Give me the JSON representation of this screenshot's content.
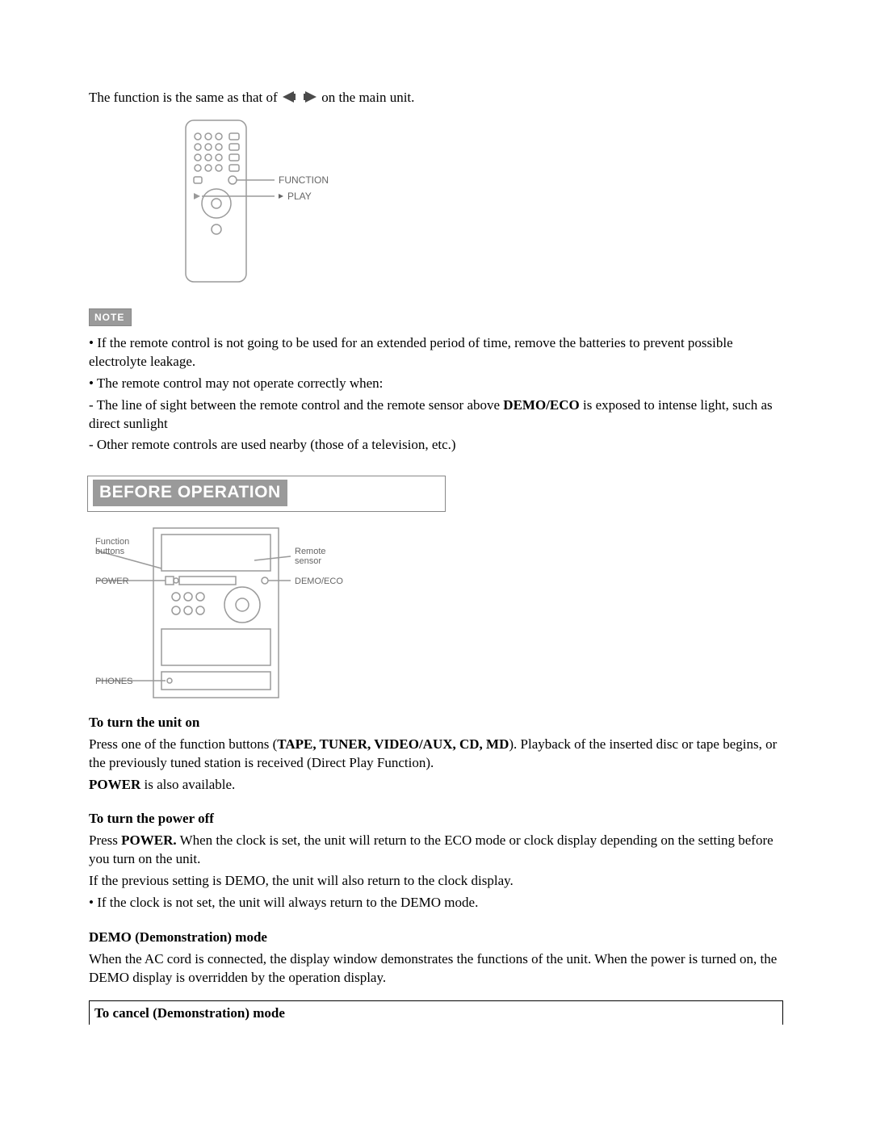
{
  "intro": {
    "pre": "The function is the same as that of ",
    "post": " on the main unit."
  },
  "remote_fig": {
    "label_function": "FUNCTION",
    "label_play": "PLAY"
  },
  "note": {
    "badge": "NOTE",
    "bullet1": "• If the remote control is not going to be used for an extended period of time, remove the batteries to prevent possible electrolyte leakage.",
    "bullet2": "• The remote control may not operate correctly when:",
    "sub1_pre": " - The line of sight between the remote control and the remote sensor above ",
    "sub1_bold": "DEMO/ECO",
    "sub1_post": " is exposed to intense light, such as direct sunlight",
    "sub2": " - Other remote controls are used nearby (those of a television, etc.)"
  },
  "before_op": {
    "heading": "BEFORE OPERATION",
    "fig": {
      "label_function_buttons_l1": "Function",
      "label_function_buttons_l2": "buttons",
      "label_power": "POWER",
      "label_phones": "PHONES",
      "label_remote_sensor_l1": "Remote",
      "label_remote_sensor_l2": "sensor",
      "label_demo_eco": "DEMO/ECO"
    }
  },
  "turn_on": {
    "heading": "To turn the unit on",
    "l1_pre": "Press one of the function buttons (",
    "l1_bold": "TAPE, TUNER, VIDEO/AUX, CD, MD",
    "l1_post": "). Playback of the inserted disc or tape begins, or the previously tuned station is received (Direct Play Function).",
    "l2_bold": "POWER",
    "l2_post": " is also available."
  },
  "turn_off": {
    "heading": "To turn the power off",
    "l1_pre": "Press ",
    "l1_bold": "POWER.",
    "l1_post": " When the clock is set, the unit will return to the ECO mode or clock display depending on the setting before you turn on the unit.",
    "l2": "If the previous setting is DEMO, the unit will also return to the clock display.",
    "l3": "• If the clock is not set, the unit will always return to the DEMO mode."
  },
  "demo": {
    "heading": "DEMO (Demonstration) mode",
    "l1": "When the AC cord is connected, the display window demonstrates the functions of the unit. When the power is turned on, the DEMO display is overridden by the operation display."
  },
  "cancel": {
    "heading": "To cancel (Demonstration) mode"
  }
}
